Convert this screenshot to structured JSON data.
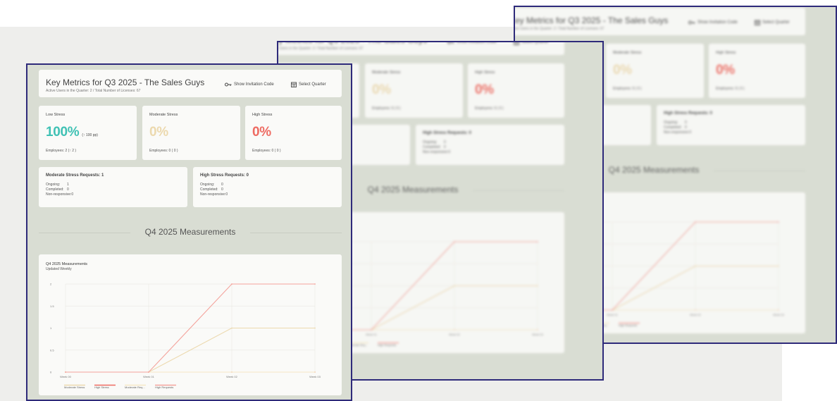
{
  "dashboard": {
    "title": "Key Metrics for Q3 2025 - The Sales Guys",
    "subtitle": "Active Users in the Quarter: 2 / Total Number of Licenses: 67",
    "show_invitation_code": "Show Invitation Code",
    "select_quarter": "Select Quarter",
    "stress_cards": [
      {
        "label": "Low Stress",
        "value": "100%",
        "delta": "(↑ 100 pp)",
        "employees": "Employees: 2  (↑ 2 )"
      },
      {
        "label": "Moderate Stress",
        "value": "0%",
        "delta": "",
        "employees": "Employees: 0  ( 0 )"
      },
      {
        "label": "High Stress",
        "value": "0%",
        "delta": "",
        "employees": "Employees: 0  ( 0 )"
      }
    ],
    "requests": [
      {
        "title": "Moderate Stress Requests: 1",
        "ongoing_label": "Ongoing:",
        "ongoing": "1",
        "completed_label": "Completed:",
        "completed": "0",
        "nonresponsive_label": "Non-responsive:",
        "nonresponsive": "0"
      },
      {
        "title": "High Stress Requests: 0",
        "ongoing_label": "Ongoing:",
        "ongoing": "0",
        "completed_label": "Completed:",
        "completed": "0",
        "nonresponsive_label": "Non-responsive:",
        "nonresponsive": "0"
      }
    ],
    "section_heading": "Q4 2025 Measurements",
    "chart_title": "Q4 2025 Measurements",
    "chart_subtitle": "Updated Weekly"
  },
  "colors": {
    "frame_border": "#2e2a7a",
    "low": "#3fc1b4",
    "moderate": "#ecd9ae",
    "high": "#ee6b62",
    "high_requests": "#f4a39c"
  },
  "chart_data": {
    "type": "line",
    "title": "Q4 2025 Measurements",
    "subtitle": "Updated Weekly",
    "x": [
      "Week 00",
      "Week 01",
      "Week 02",
      "Week 03"
    ],
    "ylim": [
      0,
      2
    ],
    "yticks": [
      "0",
      "0.5",
      "1",
      "1.5",
      "2"
    ],
    "grid": true,
    "legend_position": "bottom-left",
    "series": [
      {
        "name": "Moderate Stress",
        "values": [
          0,
          0,
          1,
          1
        ],
        "color": "#ecd9ae"
      },
      {
        "name": "High Stress",
        "values": [
          0,
          0,
          0,
          0
        ],
        "color": "#ee6b62"
      },
      {
        "name": "Moderate Req...",
        "values": [
          0,
          0,
          0,
          0
        ],
        "color": "#f6e7c6"
      },
      {
        "name": "High Requests",
        "values": [
          0,
          0,
          2,
          2
        ],
        "color": "#f4a39c"
      }
    ]
  }
}
